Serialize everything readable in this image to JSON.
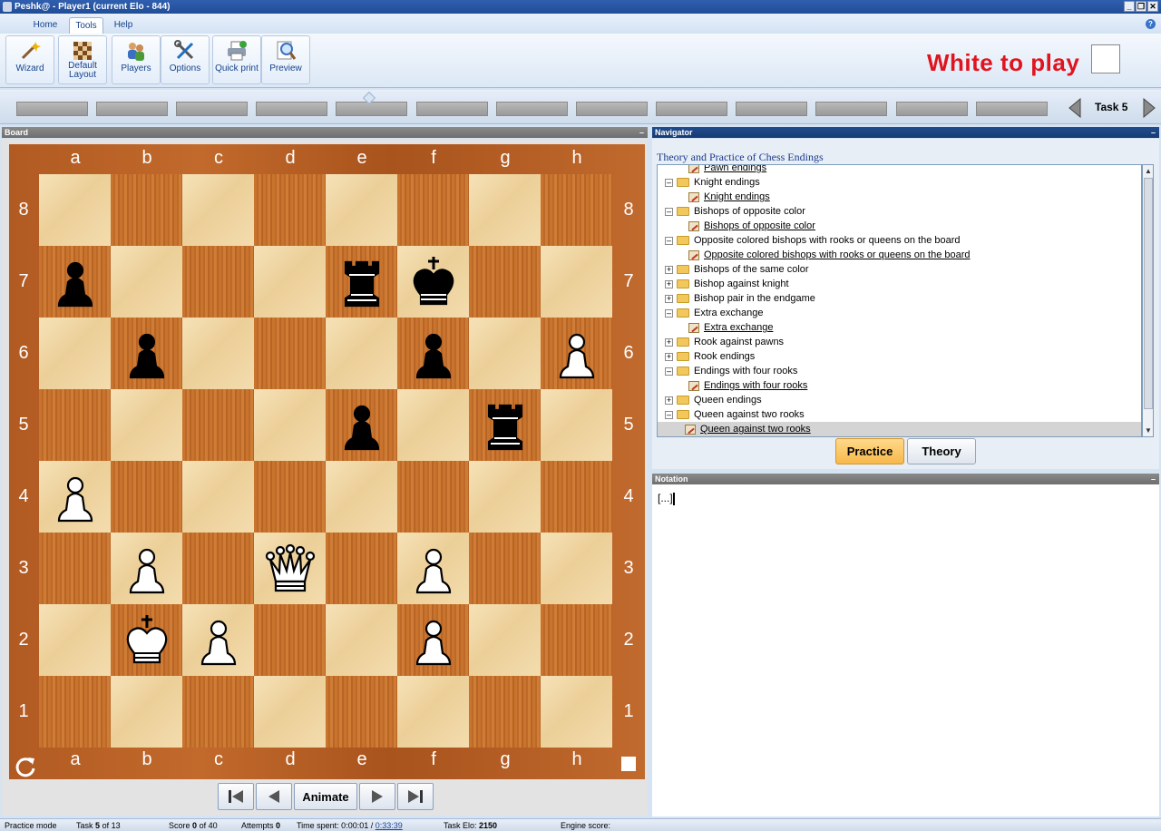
{
  "window": {
    "title": "Peshk@ - Player1 (current Elo - 844)"
  },
  "ribbon": {
    "tabs": [
      {
        "label": "Home"
      },
      {
        "label": "Tools"
      },
      {
        "label": "Help"
      }
    ],
    "active_tab": "Tools",
    "buttons": [
      {
        "label": "Wizard",
        "icon": "wizard-icon"
      },
      {
        "label": "Default Layout",
        "icon": "layout-icon"
      },
      {
        "label": "Players",
        "icon": "players-icon"
      },
      {
        "label": "Options",
        "icon": "options-icon"
      },
      {
        "label": "Quick print",
        "icon": "printer-icon"
      },
      {
        "label": "Preview",
        "icon": "preview-icon"
      }
    ]
  },
  "status": {
    "message": "White to play",
    "color": "#e0141e"
  },
  "task": {
    "label": "Task 5"
  },
  "board_panel": {
    "title": "Board",
    "files": [
      "a",
      "b",
      "c",
      "d",
      "e",
      "f",
      "g",
      "h"
    ],
    "ranks": [
      "8",
      "7",
      "6",
      "5",
      "4",
      "3",
      "2",
      "1"
    ],
    "pieces": [
      {
        "square": "a7",
        "piece": "pawn",
        "color": "black"
      },
      {
        "square": "e7",
        "piece": "rook",
        "color": "black"
      },
      {
        "square": "f7",
        "piece": "king",
        "color": "black"
      },
      {
        "square": "b6",
        "piece": "pawn",
        "color": "black"
      },
      {
        "square": "f6",
        "piece": "pawn",
        "color": "black"
      },
      {
        "square": "h6",
        "piece": "pawn",
        "color": "white"
      },
      {
        "square": "e5",
        "piece": "pawn",
        "color": "black"
      },
      {
        "square": "g5",
        "piece": "rook",
        "color": "black"
      },
      {
        "square": "a4",
        "piece": "pawn",
        "color": "white"
      },
      {
        "square": "b3",
        "piece": "pawn",
        "color": "white"
      },
      {
        "square": "d3",
        "piece": "queen",
        "color": "white"
      },
      {
        "square": "f3",
        "piece": "pawn",
        "color": "white"
      },
      {
        "square": "b2",
        "piece": "king",
        "color": "white"
      },
      {
        "square": "c2",
        "piece": "pawn",
        "color": "white"
      },
      {
        "square": "f2",
        "piece": "pawn",
        "color": "white"
      }
    ],
    "controls": {
      "animate_label": "Animate"
    }
  },
  "navigator": {
    "title": "Navigator",
    "heading": "Theory and Practice of Chess Endings",
    "items": [
      {
        "label": "Pawn endings",
        "type": "leaf"
      },
      {
        "label": "Knight endings",
        "type": "folder",
        "expanded": true
      },
      {
        "label": "Knight endings",
        "type": "leaf"
      },
      {
        "label": "Bishops of opposite color",
        "type": "folder",
        "expanded": true
      },
      {
        "label": "Bishops of opposite color",
        "type": "leaf"
      },
      {
        "label": "Opposite colored bishops with rooks or queens on the board",
        "type": "folder",
        "expanded": true
      },
      {
        "label": "Opposite colored bishops with rooks or queens on the board",
        "type": "leaf"
      },
      {
        "label": "Bishops of the same color",
        "type": "folder",
        "expanded": false
      },
      {
        "label": "Bishop against knight",
        "type": "folder",
        "expanded": false
      },
      {
        "label": "Bishop pair in the endgame",
        "type": "folder",
        "expanded": false
      },
      {
        "label": "Extra exchange",
        "type": "folder",
        "expanded": true
      },
      {
        "label": "Extra exchange",
        "type": "leaf"
      },
      {
        "label": "Rook against pawns",
        "type": "folder",
        "expanded": false
      },
      {
        "label": "Rook endings",
        "type": "folder",
        "expanded": false
      },
      {
        "label": "Endings with four rooks",
        "type": "folder",
        "expanded": true
      },
      {
        "label": "Endings with four rooks",
        "type": "leaf"
      },
      {
        "label": "Queen endings",
        "type": "folder",
        "expanded": false
      },
      {
        "label": "Queen against two rooks",
        "type": "folder",
        "expanded": true
      },
      {
        "label": "Queen against two rooks",
        "type": "leaf",
        "selected": true
      }
    ],
    "practice_label": "Practice",
    "theory_label": "Theory"
  },
  "notation": {
    "title": "Notation",
    "text": "[...]"
  },
  "statusbar": {
    "mode": "Practice mode",
    "task_prefix": "Task",
    "task_num": "5",
    "task_suffix": "of 13",
    "score_prefix": "Score",
    "score_num": "0",
    "score_suffix": "of 40",
    "attempts_prefix": "Attempts",
    "attempts_num": "0",
    "time_prefix": "Time spent: 0:00:01 /",
    "time_total": "0:33:39",
    "elo_prefix": "Task Elo:",
    "elo_num": "2150",
    "engine_label": "Engine score:"
  }
}
